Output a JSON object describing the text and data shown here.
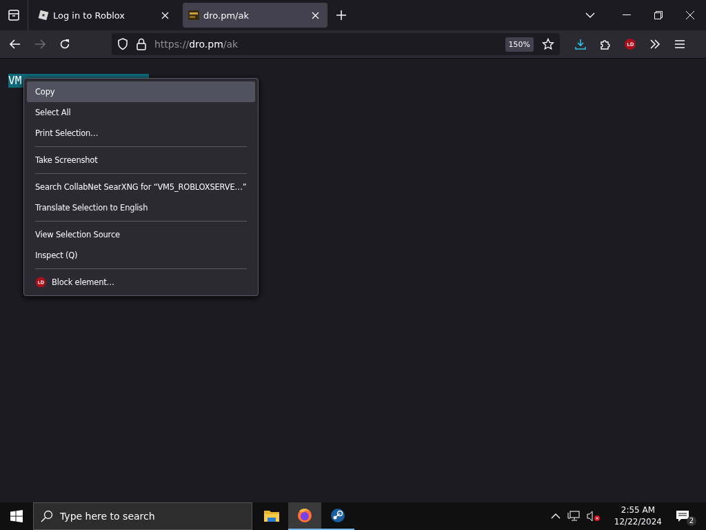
{
  "tabs": [
    {
      "title": "Log in to Roblox",
      "selected": false,
      "kind": "roblox"
    },
    {
      "title": "dro.pm/ak",
      "selected": true,
      "kind": "site"
    }
  ],
  "toolbar": {
    "url_scheme": "https://",
    "url_host": "dro.pm",
    "url_path": "/ak",
    "zoom": "150%"
  },
  "page": {
    "selected_text": "VM"
  },
  "context_menu": [
    {
      "kind": "item",
      "label": "Copy",
      "selected": true
    },
    {
      "kind": "item",
      "label": "Select All",
      "selected": false
    },
    {
      "kind": "item",
      "label": "Print Selection…",
      "selected": false
    },
    {
      "kind": "separator"
    },
    {
      "kind": "item",
      "label": "Take Screenshot",
      "selected": false
    },
    {
      "kind": "separator"
    },
    {
      "kind": "item",
      "label": "Search CollabNet SearXNG for “VM5_ROBLOXSERVE…”",
      "selected": false
    },
    {
      "kind": "item",
      "label": "Translate Selection to English",
      "selected": false
    },
    {
      "kind": "separator"
    },
    {
      "kind": "item",
      "label": "View Selection Source",
      "selected": false
    },
    {
      "kind": "item",
      "label": "Inspect (Q)",
      "selected": false
    },
    {
      "kind": "separator"
    },
    {
      "kind": "extension",
      "label": "Block element…",
      "selected": false
    }
  ],
  "taskbar": {
    "search_placeholder": "Type here to search",
    "apps": [
      {
        "kind": "folder",
        "running": false,
        "selected": false
      },
      {
        "kind": "firefox",
        "running": true,
        "selected": true
      },
      {
        "kind": "steam",
        "running": true,
        "selected": false
      }
    ],
    "time": "2:55 AM",
    "date": "12/22/2024",
    "notifications": "2"
  }
}
